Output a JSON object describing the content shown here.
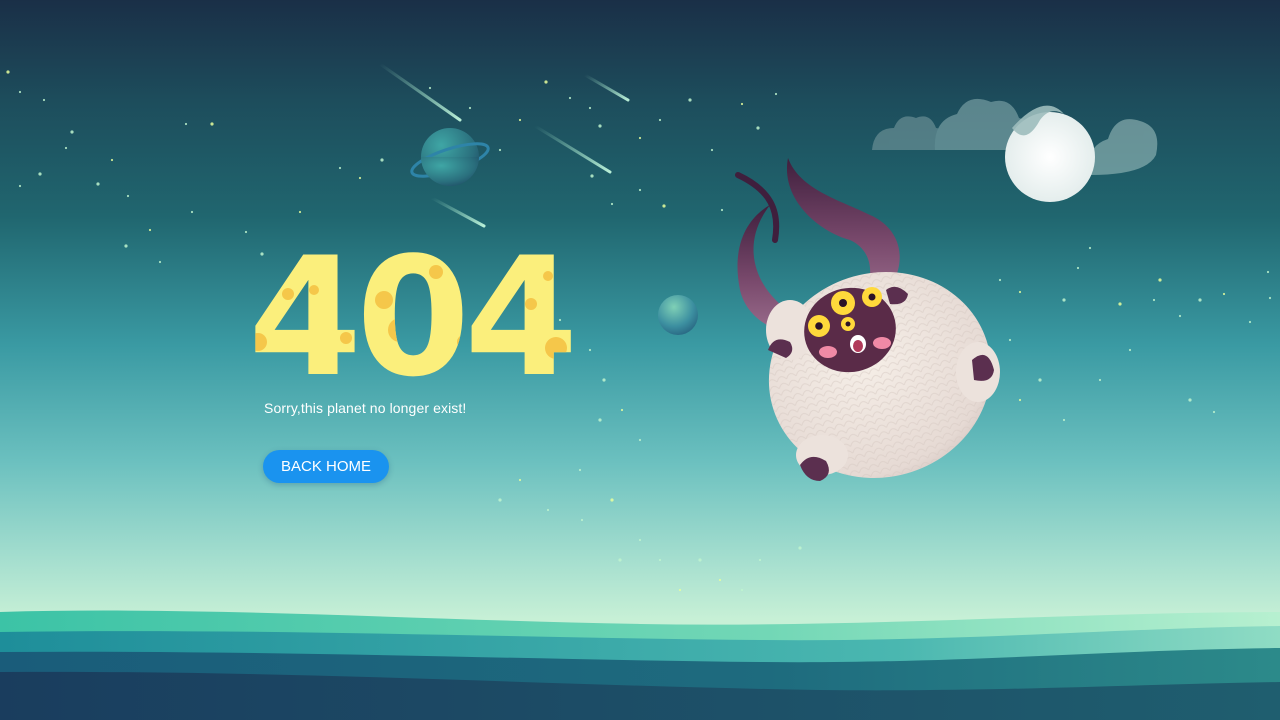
{
  "error": {
    "code": "404",
    "message": "Sorry,this planet no longer exist!"
  },
  "actions": {
    "back_home_label": "BACK HOME"
  },
  "colors": {
    "digits": "#fbef7c",
    "digit_spots": "#f5c74a",
    "button": "#1a93ef",
    "creature_fur": "#eee3dc",
    "horns": "#6e3b60",
    "sky_top": "#1a2f47",
    "horizon": "#c7f0d6"
  },
  "icons": {
    "ringed_planet": "ringed-planet-icon",
    "small_planet": "small-planet-icon",
    "moon": "moon-icon",
    "creature": "monster-illustration"
  }
}
